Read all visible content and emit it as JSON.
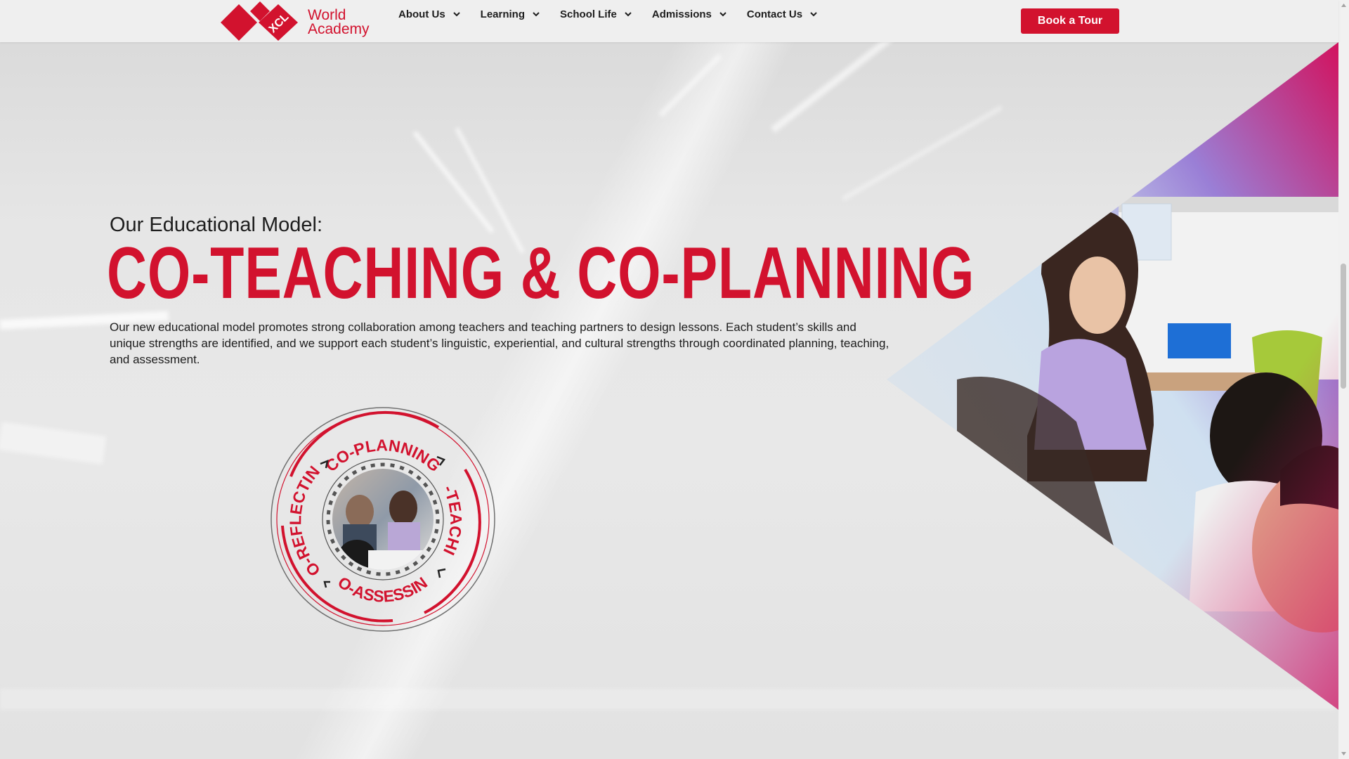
{
  "brand": {
    "logo_letters": "XCL",
    "name_line1": "World",
    "name_line2": "Academy",
    "accent": "#d2122e"
  },
  "nav": {
    "items": [
      {
        "label": "About Us"
      },
      {
        "label": "Learning"
      },
      {
        "label": "School Life"
      },
      {
        "label": "Admissions"
      },
      {
        "label": "Contact Us"
      }
    ],
    "cta_label": "Book a Tour"
  },
  "hero": {
    "subtitle": "Our Educational Model:",
    "headline": "CO-TEACHING & CO-PLANNING",
    "body": "Our new educational model promotes strong collaboration among teachers and teaching partners to design lessons. Each student’s skills and unique strengths are identified, and we support each student’s linguistic, experiential, and cultural strengths through coordinated planning, teaching, and assessment."
  },
  "cycle": {
    "top": "CO-PLANNING",
    "right": "CO-TEACHING",
    "bottom": "CO-ASSESSING",
    "left": "CO-REFLECTING"
  },
  "icons": {
    "chevron": "chevron-down-icon",
    "logo": "xcl-diamond-logo-icon"
  }
}
